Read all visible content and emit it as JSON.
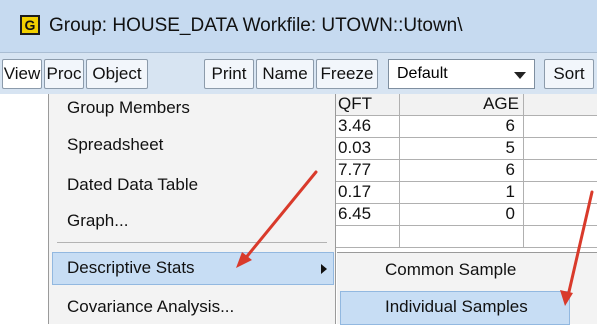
{
  "window": {
    "icon_letter": "G",
    "title": "Group: HOUSE_DATA   Workfile: UTOWN::Utown\\"
  },
  "toolbar": {
    "buttons": [
      "View",
      "Proc",
      "Object",
      "Print",
      "Name",
      "Freeze",
      "Sort"
    ],
    "dropdown_value": "Default"
  },
  "grid": {
    "columns": [
      "QFT",
      "AGE"
    ],
    "rows": [
      [
        "3.46",
        "6"
      ],
      [
        "0.03",
        "5"
      ],
      [
        "7.77",
        "6"
      ],
      [
        "0.17",
        "1"
      ],
      [
        "6.45",
        "0"
      ]
    ]
  },
  "view_menu": {
    "items": [
      "Group Members",
      "Spreadsheet",
      "Dated Data Table",
      "Graph...",
      "Descriptive Stats",
      "Covariance Analysis..."
    ],
    "highlighted_item": "Descriptive Stats"
  },
  "submenu": {
    "items": [
      "Common Sample",
      "Individual Samples"
    ],
    "highlighted_item": "Individual Samples"
  },
  "annotations": {
    "arrow_color": "#d93a2b"
  }
}
